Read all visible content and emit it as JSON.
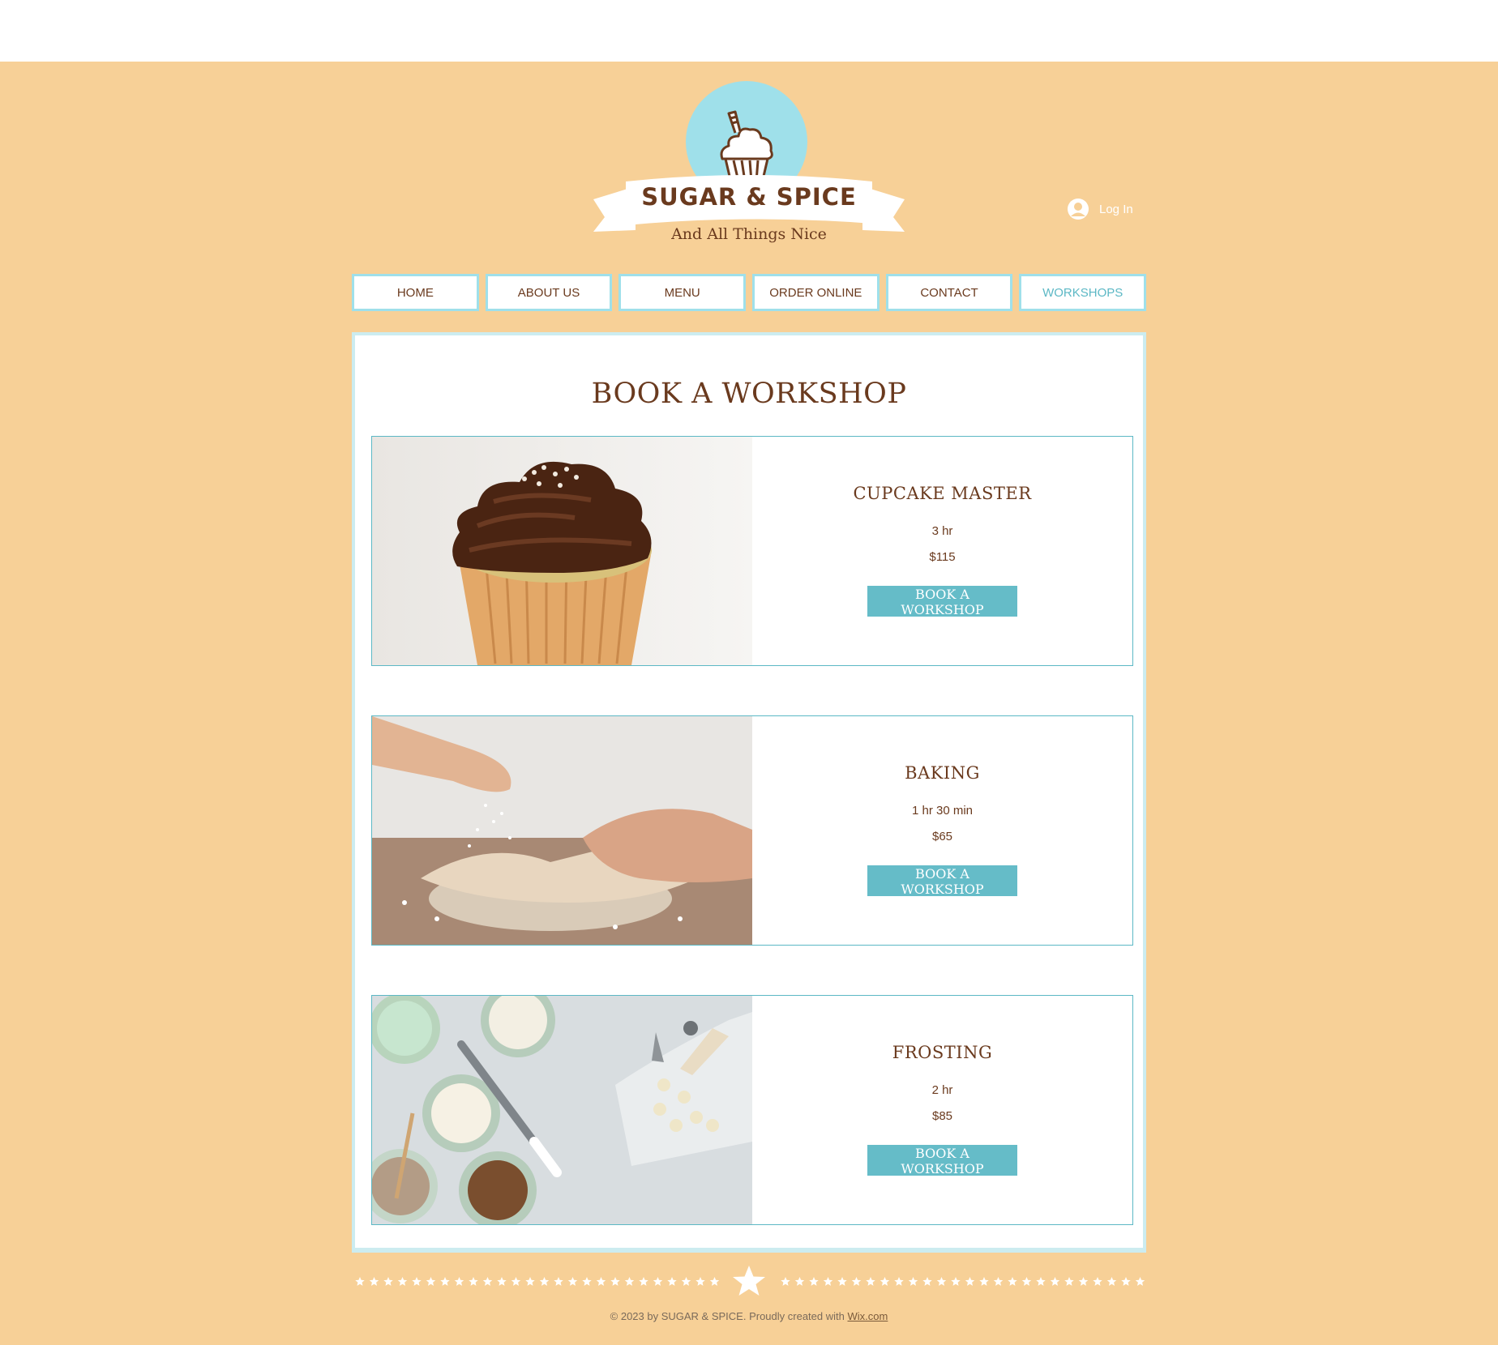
{
  "header": {
    "brand": "SUGAR & SPICE",
    "tagline": "And All Things Nice",
    "login_label": "Log In"
  },
  "nav": {
    "items": [
      {
        "label": "HOME"
      },
      {
        "label": "ABOUT US"
      },
      {
        "label": "MENU"
      },
      {
        "label": "ORDER ONLINE"
      },
      {
        "label": "CONTACT"
      },
      {
        "label": "WORKSHOPS"
      }
    ],
    "active": "WORKSHOPS"
  },
  "main": {
    "title": "BOOK A WORKSHOP",
    "workshops": [
      {
        "name": "CUPCAKE MASTER",
        "duration": "3 hr",
        "price": "$115",
        "button": "BOOK A WORKSHOP"
      },
      {
        "name": "BAKING",
        "duration": "1 hr 30 min",
        "price": "$65",
        "button": "BOOK A WORKSHOP"
      },
      {
        "name": "FROSTING",
        "duration": "2 hr",
        "price": "$85",
        "button": "BOOK A WORKSHOP"
      }
    ]
  },
  "footer": {
    "text": "© 2023 by SUGAR & SPICE. Proudly created with",
    "link": "Wix.com"
  },
  "colors": {
    "background": "#f7d097",
    "accent": "#65bcc8",
    "brown": "#6a3a1e",
    "light_blue": "#9fe0ea"
  }
}
